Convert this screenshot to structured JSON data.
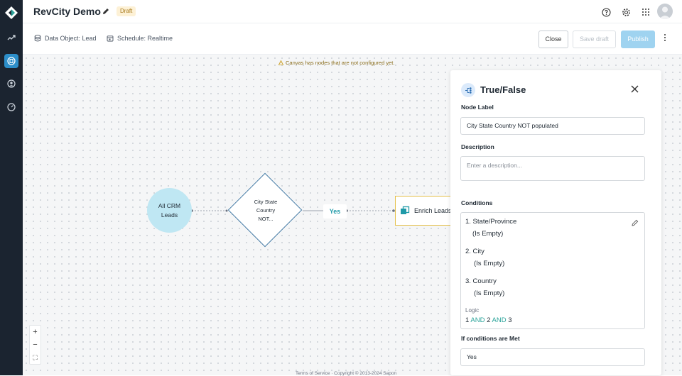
{
  "app": {
    "title": "RevCity Demo",
    "status_badge": "Draft"
  },
  "rail": {
    "items": [
      "logo-icon",
      "trend-icon",
      "flows-icon",
      "contacts-icon",
      "dashboard-icon"
    ]
  },
  "subbar": {
    "data_object": "Data Object: Lead",
    "schedule": "Schedule: Realtime",
    "close_label": "Close",
    "save_draft_label": "Save draft",
    "publish_label": "Publish"
  },
  "canvas": {
    "warning": "Canvas has nodes that are not configured yet.",
    "start_node_line1": "All CRM",
    "start_node_line2": "Leads",
    "decision_line1": "City State",
    "decision_line2": "Country",
    "decision_line3": "NOT...",
    "yes_label": "Yes",
    "enrich_label": "Enrich Leads",
    "zoom_in": "+",
    "zoom_out": "−",
    "fit": "⛶",
    "footer": "Terms of Service · Copyright © 2013-2024 Sapon"
  },
  "panel": {
    "title": "True/False",
    "node_label_heading": "Node Label",
    "node_label_value": "City State Country NOT populated",
    "description_heading": "Description",
    "description_placeholder": "Enter a description...",
    "conditions_heading": "Conditions",
    "conditions": [
      {
        "label": "1. State/Province",
        "operator": "(Is Empty)"
      },
      {
        "label": "2. City",
        "operator": "(Is Empty)"
      },
      {
        "label": "3. Country",
        "operator": "(Is Empty)"
      }
    ],
    "logic_label": "Logic",
    "logic": {
      "n1": "1",
      "and1": "AND",
      "n2": "2",
      "and2": "AND",
      "n3": "3"
    },
    "met_heading": "If conditions are Met",
    "met_value": "Yes"
  },
  "colors": {
    "rail": "#1b2430",
    "accent": "#2c8ec9",
    "teal": "#2aa39a",
    "warning": "#e4c04a"
  }
}
